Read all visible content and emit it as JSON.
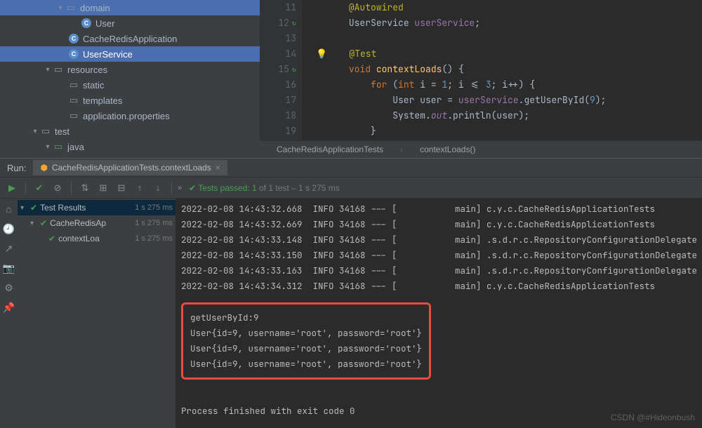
{
  "tree": {
    "domain": "domain",
    "user": "User",
    "app": "CacheRedisApplication",
    "service": "UserService",
    "resources": "resources",
    "static": "static",
    "templates": "templates",
    "props": "application.properties",
    "test": "test",
    "java": "java"
  },
  "editor": {
    "lines": {
      "l11": "11",
      "l12": "12",
      "l13": "13",
      "l14": "14",
      "l15": "15",
      "l16": "16",
      "l17": "17",
      "l18": "18",
      "l19": "19"
    },
    "code": {
      "autowired": "@Autowired",
      "userServiceType": "UserService ",
      "userServiceField": "userService",
      "semi": ";",
      "test": "@Test",
      "void": "void ",
      "contextLoads": "contextLoads",
      "parens": "() {",
      "forKw": "for ",
      "openParen": "(",
      "intKw": "int ",
      "iEq": "i = ",
      "one": "1",
      "cond": "; i <= ",
      "three": "3",
      "inc": "; i++) {",
      "userType": "User user = ",
      "svc": "userService",
      "dot": ".",
      "getUser": "getUserById(",
      "nine": "9",
      "closeCall": ");",
      "system": "System.",
      "out": "out",
      "println": ".println(user);",
      "closeBrace": "}"
    },
    "breadcrumb": {
      "class": "CacheRedisApplicationTests",
      "method": "contextLoads()"
    }
  },
  "run": {
    "label": "Run:",
    "tab": "CacheRedisApplicationTests.contextLoads"
  },
  "toolbar": {
    "tests_passed": "Tests passed: 1",
    "tests_of": " of 1 test – 1 s 275 ms"
  },
  "testResults": {
    "root": "Test Results",
    "rootTime": "1 s 275 ms",
    "class": "CacheRedisAp",
    "classTime": "1 s 275 ms",
    "method": "contextLoa",
    "methodTime": "1 s 275 ms"
  },
  "console": {
    "l1": "2022-02-08 14:43:32.668  INFO 34168 --- [           main] c.y.c.CacheRedisApplicationTests",
    "l2": "2022-02-08 14:43:32.669  INFO 34168 --- [           main] c.y.c.CacheRedisApplicationTests",
    "l3": "2022-02-08 14:43:33.148  INFO 34168 --- [           main] .s.d.r.c.RepositoryConfigurationDelegate",
    "l4": "2022-02-08 14:43:33.150  INFO 34168 --- [           main] .s.d.r.c.RepositoryConfigurationDelegate",
    "l5": "2022-02-08 14:43:33.163  INFO 34168 --- [           main] .s.d.r.c.RepositoryConfigurationDelegate",
    "l6": "2022-02-08 14:43:34.312  INFO 34168 --- [           main] c.y.c.CacheRedisApplicationTests",
    "h1": "getUserById:9",
    "h2": "User{id=9, username='root', password='root'}",
    "h3": "User{id=9, username='root', password='root'}",
    "h4": "User{id=9, username='root', password='root'}",
    "exit": "Process finished with exit code 0"
  },
  "watermark": "CSDN @#Hideonbush"
}
